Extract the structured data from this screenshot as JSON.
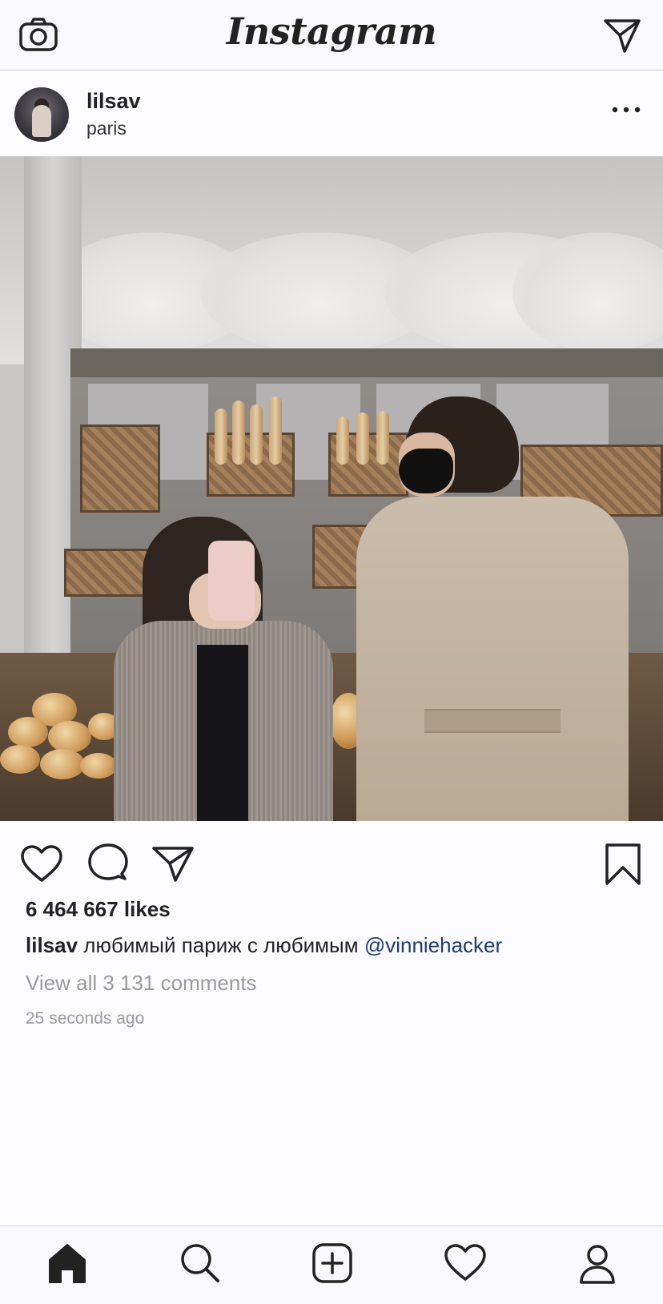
{
  "header": {
    "app_title": "Instagram",
    "left_icon": "camera-icon",
    "right_icon": "direct-message-icon"
  },
  "post": {
    "username": "lilsav",
    "location": "paris",
    "more_icon": "more-options-icon",
    "likes": "6 464 667 likes",
    "caption": {
      "username": "lilsav",
      "text": "любимый париж с любимым",
      "mention": "@vinniehacker"
    },
    "view_comments": "View all 3 131 comments",
    "timestamp": "25 seconds ago"
  },
  "actions": {
    "like_icon": "heart-icon",
    "comment_icon": "comment-icon",
    "share_icon": "share-icon",
    "save_icon": "bookmark-icon"
  },
  "bottom_nav": [
    "home-icon",
    "search-icon",
    "add-post-icon",
    "activity-heart-icon",
    "profile-icon"
  ],
  "colors": {
    "background": "#fcfbfe",
    "mention": "#1f3b6e",
    "secondary_text": "#9a9a9f"
  }
}
